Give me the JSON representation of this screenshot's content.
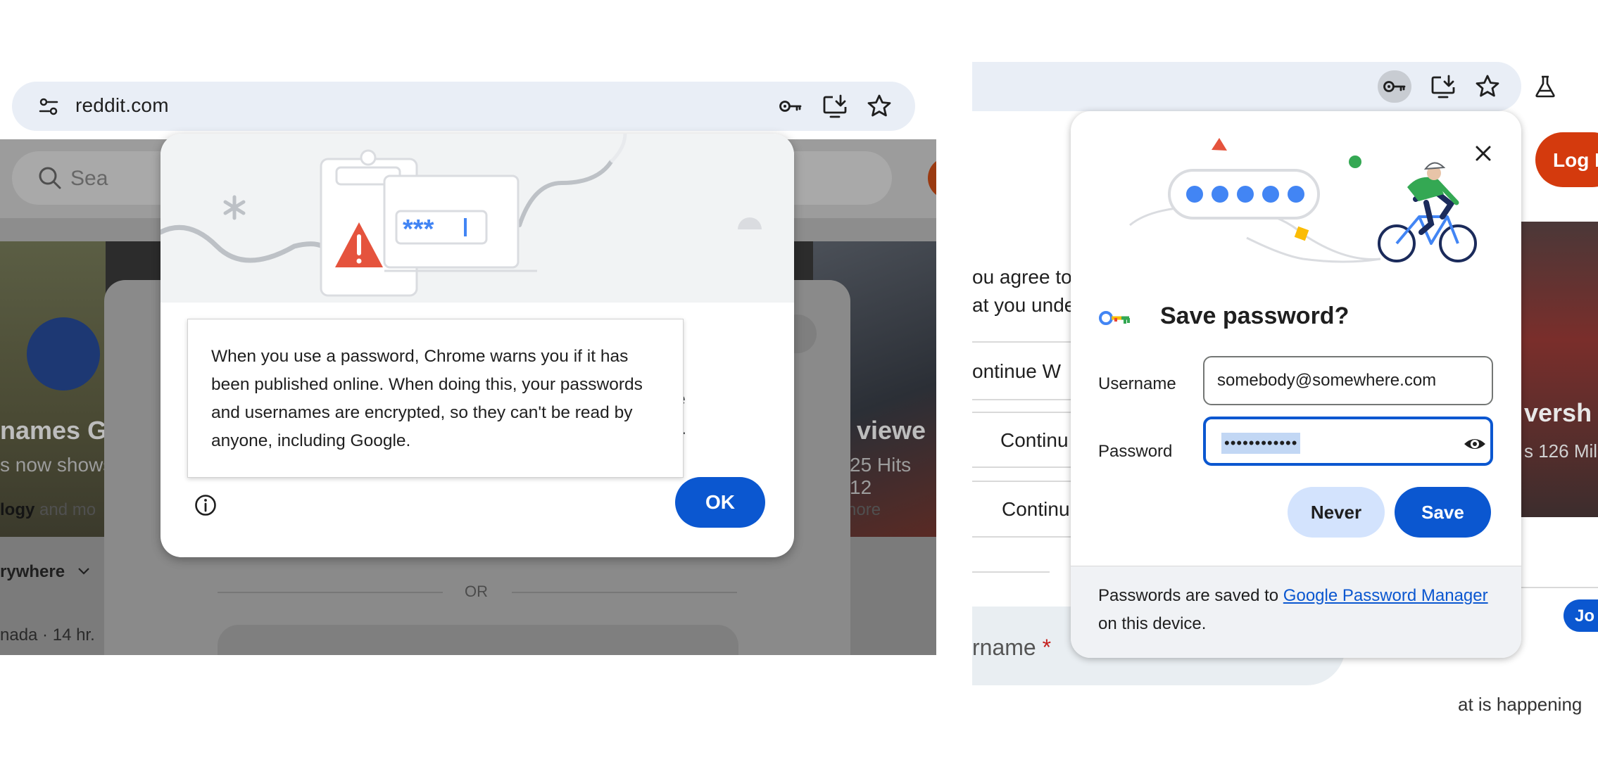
{
  "left": {
    "omnibox": {
      "url": "reddit.com",
      "icons": [
        "site-settings-icon",
        "password-key-icon",
        "install-app-icon",
        "bookmark-star-icon"
      ]
    },
    "page_behind": {
      "search_partial": "Sea",
      "hero_text_left": "names G",
      "hero_sub_left": "s now shows",
      "hero_meta_left": "logy",
      "hero_meta_left2": "and mo",
      "hero_text_right": "l viewe",
      "hero_sub_right": "25 Hits 12",
      "hero_meta_right": "nore",
      "dropdown": "rywhere",
      "post_meta": "nada · 14 hr.",
      "or_divider": "OR"
    },
    "dialog": {
      "behind_text_1": "le",
      "behind_text_2": "y.",
      "tooltip": "When you use a password, Chrome warns you if it has been published online. When doing this, your passwords and usernames are encrypted, so they can't be read by anyone, including Google.",
      "illus_stars": "***",
      "ok_label": "OK"
    }
  },
  "right": {
    "toolbar_icons": [
      "password-key-icon",
      "install-app-icon",
      "bookmark-star-icon",
      "labs-flask-icon"
    ],
    "page_behind": {
      "agree_line1": "ou agree to",
      "agree_line2": "at you unde",
      "continue_1": "ontinue W",
      "continue_2": "Continu",
      "continue_3": "Continu",
      "login": "Log I",
      "photo_text": "versh",
      "photo_sub": "s 126 Mil",
      "username_field": "rname",
      "required_mark": "*",
      "pill": "Jo",
      "bottom": "at is happening"
    },
    "save_password": {
      "title": "Save password?",
      "username_label": "Username",
      "username_value": "somebody@somewhere.com",
      "password_label": "Password",
      "password_value": "••••••••••••",
      "never_label": "Never",
      "save_label": "Save",
      "footer_prefix": "Passwords are saved to ",
      "footer_link": "Google Password Manager",
      "footer_suffix": " on this device."
    }
  },
  "colors": {
    "accent": "#0b57d0",
    "omnibox_bg": "#e9eef6",
    "warning_red": "#e5533d",
    "reddit_orange": "#d43a0d"
  }
}
